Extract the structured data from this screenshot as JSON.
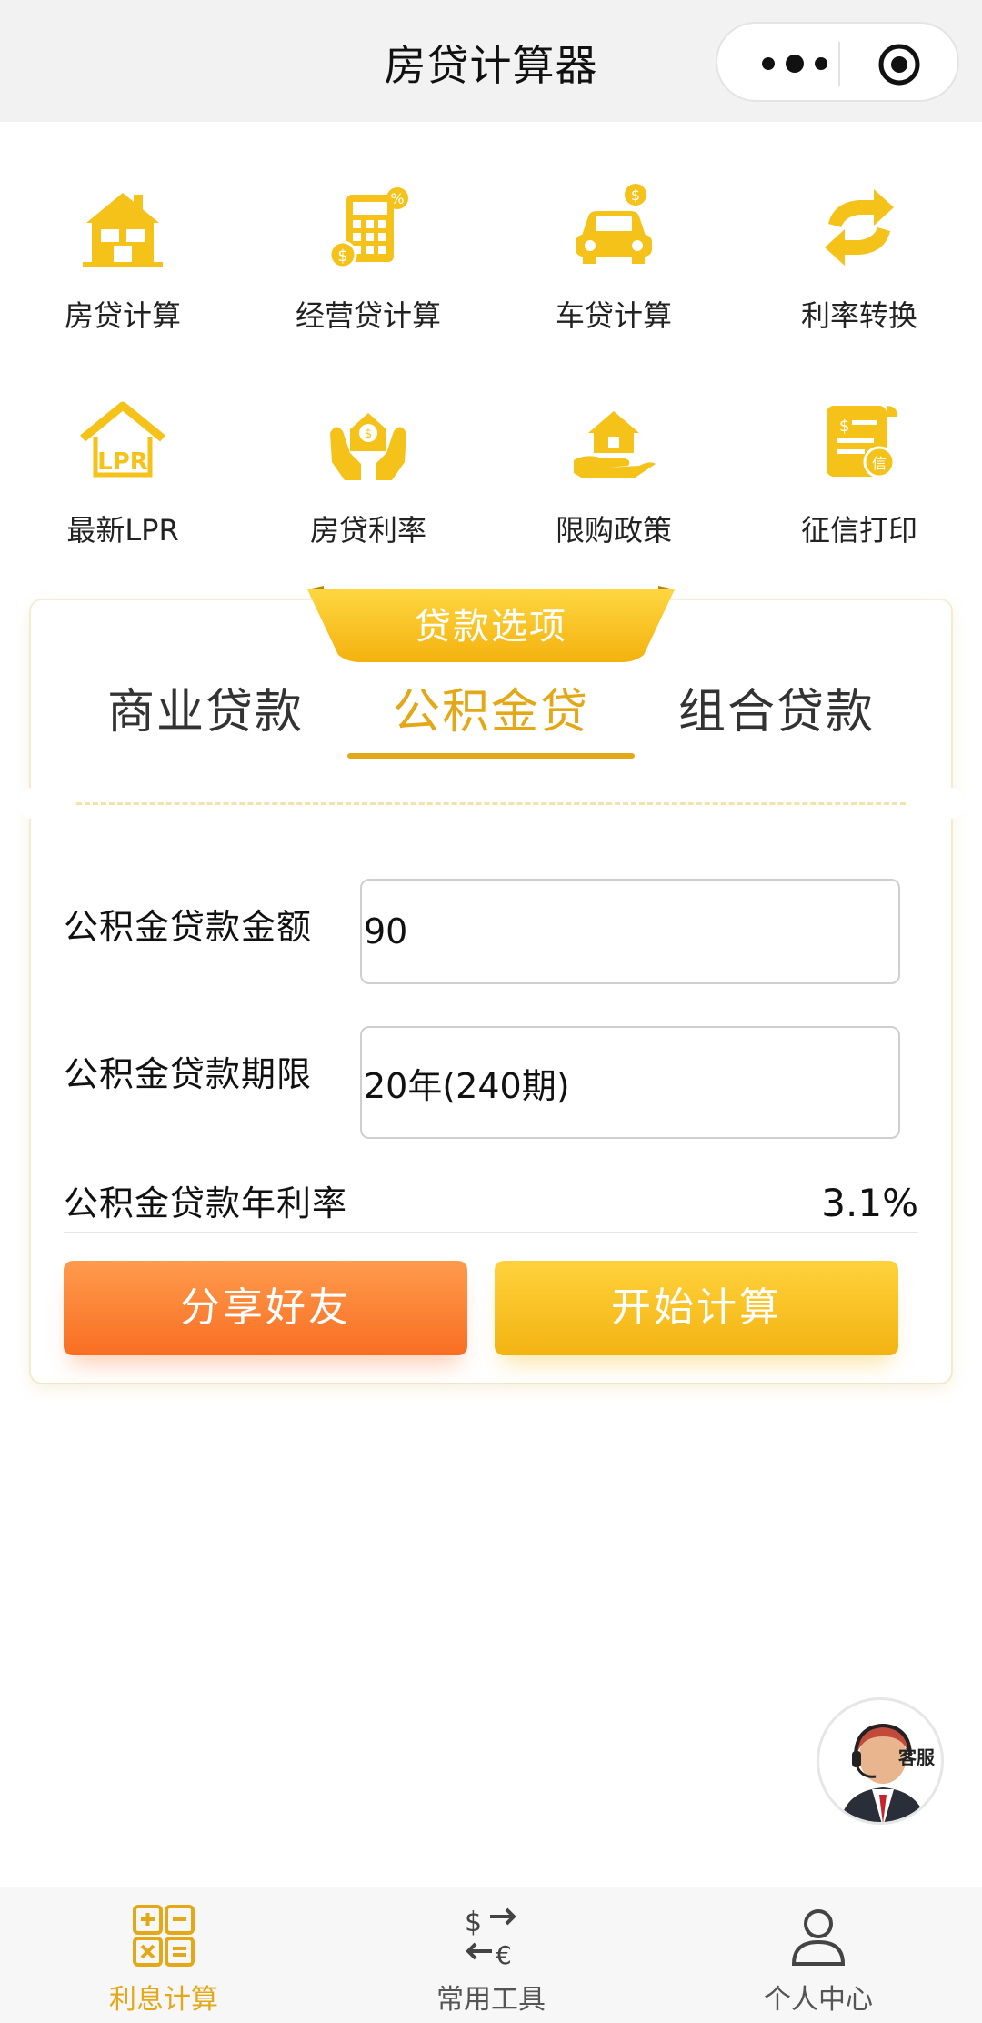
{
  "header": {
    "title": "房贷计算器"
  },
  "colors": {
    "accent": "#e3a817",
    "share_button": "#f86e22",
    "calc_button": "#f3b312",
    "icon_yellow": "#f5c21a"
  },
  "tools": [
    {
      "label": "房贷计算",
      "icon": "house-icon"
    },
    {
      "label": "经营贷计算",
      "icon": "calculator-coins-icon"
    },
    {
      "label": "车贷计算",
      "icon": "car-coin-icon"
    },
    {
      "label": "利率转换",
      "icon": "exchange-arrows-icon"
    },
    {
      "label": "最新LPR",
      "icon": "lpr-roof-icon"
    },
    {
      "label": "房贷利率",
      "icon": "hands-coin-icon"
    },
    {
      "label": "限购政策",
      "icon": "house-hand-icon"
    },
    {
      "label": "征信打印",
      "icon": "credit-document-icon"
    }
  ],
  "loan_options": {
    "ribbon": "贷款选项",
    "tabs": [
      "商业贷款",
      "公积金贷",
      "组合贷款"
    ],
    "active_tab": "公积金贷"
  },
  "form": {
    "amount_label": "公积金贷款金额",
    "amount_value": "90",
    "term_label": "公积金贷款期限",
    "term_value": "20年(240期)",
    "rate_label": "公积金贷款年利率",
    "rate_value": "3.1%"
  },
  "buttons": {
    "share": "分享好友",
    "calculate": "开始计算"
  },
  "customer_service": {
    "label": "客服"
  },
  "tabbar": [
    {
      "label": "利息计算",
      "icon": "calculator-grid-icon",
      "active": true
    },
    {
      "label": "常用工具",
      "icon": "currency-exchange-icon",
      "active": false
    },
    {
      "label": "个人中心",
      "icon": "person-icon",
      "active": false
    }
  ]
}
